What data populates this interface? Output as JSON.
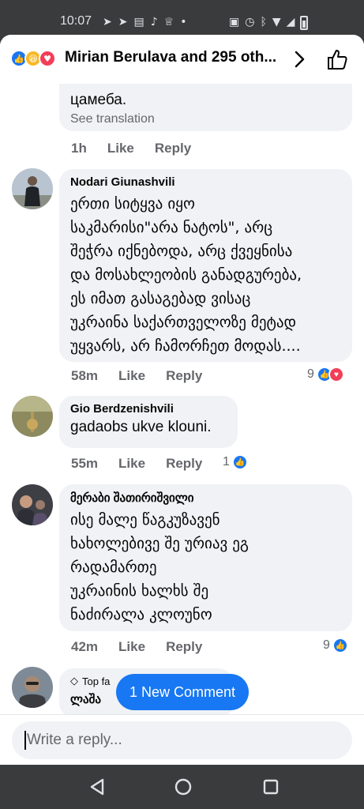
{
  "status_bar": {
    "time": "10:07"
  },
  "header": {
    "title": "Mirian Berulava and 295 oth...",
    "reaction_icons": [
      "like-icon",
      "haha-icon",
      "love-icon"
    ]
  },
  "comments": [
    {
      "partial": true,
      "text": "цамеба.",
      "see_translation": "See translation",
      "time": "1h",
      "like_label": "Like",
      "reply_label": "Reply"
    },
    {
      "author": "Nodari Giunashvili",
      "lines": [
        "ერთი სიტყვა იყო",
        "საკმარისი\"არა ნატოს\", არც",
        "შეჭრა იქნებოდა, არც ქვეყნისა",
        "და მოსახლეობის განადგურება,",
        "ეს იმათ გასაგებად ვისაც",
        "უკრაინა საქართველოზე მეტად",
        "უყვარს, არ ჩამორჩეთ მოდას...."
      ],
      "time": "58m",
      "like_label": "Like",
      "reply_label": "Reply",
      "reaction_count": "9",
      "reactions": [
        "like-icon",
        "love-icon"
      ]
    },
    {
      "author": "Gio Berdzenishvili",
      "text": "gadaobs ukve klouni.",
      "time": "55m",
      "like_label": "Like",
      "reply_label": "Reply",
      "reaction_count": "1",
      "reactions": [
        "like-icon"
      ]
    },
    {
      "author": "მერაბი შათირიშვილი",
      "lines": [
        "ისე მალე  წაგკუზავენ",
        "ხახოლებივე შე ურიავ ეგ",
        "რადამართე",
        "უკრაინის ხალხს შე",
        "ნაძირალა კლოუნო"
      ],
      "time": "42m",
      "like_label": "Like",
      "reply_label": "Reply",
      "reaction_count": "9",
      "reactions": [
        "like-icon"
      ]
    },
    {
      "badge": "Top fa",
      "author": "ლაშა"
    }
  ],
  "new_comment_button": "1 New Comment",
  "reply_input": {
    "placeholder": "Write a reply..."
  },
  "colors": {
    "accent": "#1877f2",
    "love": "#f33e58",
    "haha": "#f7b928",
    "bubble_bg": "#f0f2f5",
    "meta_text": "#65676b"
  }
}
